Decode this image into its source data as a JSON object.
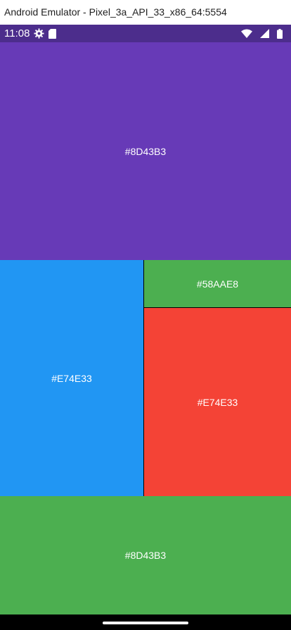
{
  "window": {
    "title": "Android Emulator - Pixel_3a_API_33_x86_64:5554"
  },
  "status_bar": {
    "time": "11:08",
    "icons_left": [
      "gear-icon",
      "sd-card-icon"
    ],
    "icons_right": [
      "wifi-icon",
      "cell-signal-icon",
      "battery-icon"
    ],
    "background": "#4c2d8c"
  },
  "blocks": [
    {
      "label": "#8D43B3",
      "color": "#673ab7"
    },
    {
      "label": "#E74E33",
      "color": "#2196f3"
    },
    {
      "label": "#58AAE8",
      "color": "#4caf50"
    },
    {
      "label": "#E74E33",
      "color": "#f44336"
    },
    {
      "label": "#8D43B3",
      "color": "#4caf50"
    }
  ],
  "nav_bar": {
    "gesture": "home-pill"
  }
}
